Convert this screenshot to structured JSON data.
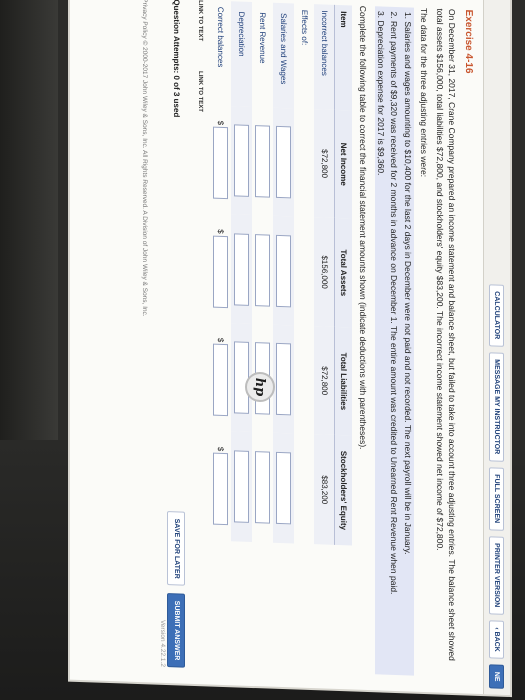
{
  "toolbar": {
    "buttons": [
      "CALCULATOR",
      "MESSAGE MY INSTRUCTOR",
      "FULL SCREEN",
      "PRINTER VERSION",
      "‹ BACK",
      "NE"
    ]
  },
  "exercise": {
    "title": "Exercise 4-16",
    "intro": "On December 31, 2017, Crane Company prepared an income statement and balance sheet, but failed to take into account three adjusting entries. The balance sheet showed total assets $156,000, total liabilities $72,800, and stockholders' equity $83,200. The incorrect income statement showed net income of $72,800.",
    "data_intro": "The data for the three adjusting entries were:",
    "entries": [
      "Salaries and wages amounting to $10,400 for the last 2 days in December were not paid and not recorded. The next payroll will be in January.",
      "Rent payments of $9,320 was received for 2 months in advance on December 1. The entire amount was credited to Unearned Rent Revenue when paid.",
      "Depreciation expense for 2017 is $9,360."
    ],
    "instruction": "Complete the following table to correct the financial statement amounts shown (indicate deductions with parentheses)."
  },
  "table": {
    "headers": [
      "Item",
      "Net Income",
      "Total Assets",
      "Total Liabilities",
      "Stockholders' Equity"
    ],
    "incorrect_label": "Incorrect balances",
    "incorrect_values": [
      "$72,800",
      "$156,000",
      "$72,800",
      "$83,200"
    ],
    "effects_label": "Effects of:",
    "effect_rows": [
      "Salaries and Wages",
      "Rent Revenue",
      "Depreciation"
    ],
    "correct_label": "Correct balances",
    "dollar": "$"
  },
  "links": [
    "LINK TO TEXT",
    "LINK TO TEXT"
  ],
  "attempts": "Question Attempts: 0 of 3 used",
  "save_label": "SAVE FOR LATER",
  "submit_label": "SUBMIT ANSWER",
  "footer": "Privacy Policy  © 2000-2017 John Wiley & Sons, Inc. All Rights Reserved. A Division of John Wiley & Sons, Inc.",
  "version": "Version 4.22.1.2",
  "logo": "hp"
}
